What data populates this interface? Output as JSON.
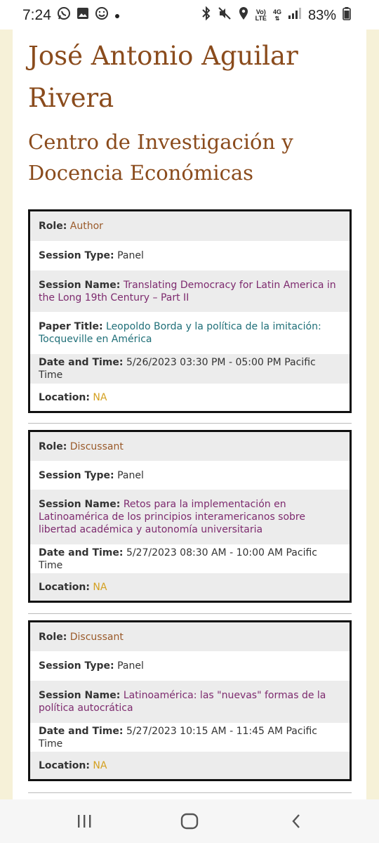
{
  "status_bar": {
    "time": "7:24",
    "battery": "83%",
    "net_top": "Vo)",
    "net_bottom": "LTE",
    "gen": "4G"
  },
  "profile": {
    "name": "José Antonio Aguilar Rivera",
    "institution": "Centro de Investigación y Docencia Económicas"
  },
  "labels": {
    "role": "Role:",
    "session_type": "Session Type:",
    "session_name": "Session Name:",
    "paper_title": "Paper Title:",
    "date_time": "Date and Time:",
    "location": "Location:"
  },
  "sessions": [
    {
      "role": "Author",
      "session_type": "Panel",
      "session_name": "Translating Democracy for Latin America in the Long 19th Century – Part II",
      "paper_title": "Leopoldo Borda y la política de la imitación: Tocqueville en América",
      "date_time": "5/26/2023 03:30 PM - 05:00 PM Pacific Time",
      "location": "NA"
    },
    {
      "role": "Discussant",
      "session_type": "Panel",
      "session_name": "Retos para la implementación en Latinoamérica de los principios interamericanos sobre libertad académica y autonomía universitaria",
      "date_time": "5/27/2023 08:30 AM - 10:00 AM Pacific Time",
      "location": "NA"
    },
    {
      "role": "Discussant",
      "session_type": "Panel",
      "session_name": "Latinoamérica: las \"nuevas\" formas de la política autocrática",
      "date_time": "5/27/2023 10:15 AM - 11:45 AM Pacific Time",
      "location": "NA"
    }
  ],
  "colors": {
    "background": "#f6f1d8",
    "heading": "#8a4b1c",
    "role_value": "#9a5a2a",
    "session_name_value": "#7d2a6e",
    "paper_title_value": "#1f6f78",
    "location_value": "#d4a020"
  },
  "icons": [
    "whatsapp-icon",
    "gallery-icon",
    "face-icon",
    "bluetooth-icon",
    "mute-icon",
    "location-icon",
    "signal-icon",
    "battery-icon",
    "recents-icon",
    "home-icon",
    "back-icon"
  ]
}
